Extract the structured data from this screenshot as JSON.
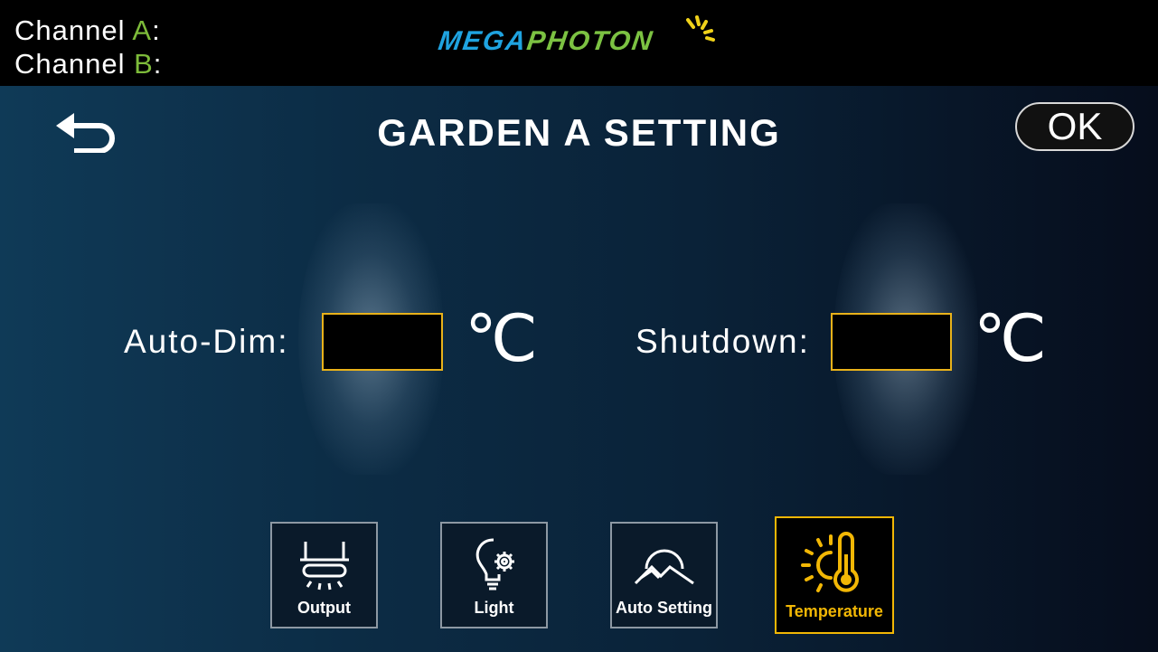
{
  "header": {
    "channel_a_prefix": "Channel ",
    "channel_a_letter": "A",
    "channel_a_suffix": ":",
    "channel_b_prefix": "Channel ",
    "channel_b_letter": "B",
    "channel_b_suffix": ":",
    "logo_part1": "MEGA",
    "logo_part2": "PHOTON"
  },
  "page": {
    "title": "GARDEN A SETTING",
    "ok_label": "OK"
  },
  "fields": {
    "auto_dim_label": "Auto-Dim:",
    "auto_dim_value": "",
    "auto_dim_unit": "℃",
    "shutdown_label": "Shutdown:",
    "shutdown_value": "",
    "shutdown_unit": "℃"
  },
  "nav": [
    {
      "label": "Output",
      "icon": "output-lamp-icon",
      "active": false
    },
    {
      "label": "Light",
      "icon": "lightbulb-gear-icon",
      "active": false
    },
    {
      "label": "Auto Setting",
      "icon": "sunrise-mountain-icon",
      "active": false
    },
    {
      "label": "Temperature",
      "icon": "sun-thermometer-icon",
      "active": true
    }
  ],
  "colors": {
    "accent_yellow": "#f2b705",
    "channel_green": "#7dbb3a",
    "logo_blue": "#1fa3e0",
    "logo_green": "#7cc242"
  }
}
